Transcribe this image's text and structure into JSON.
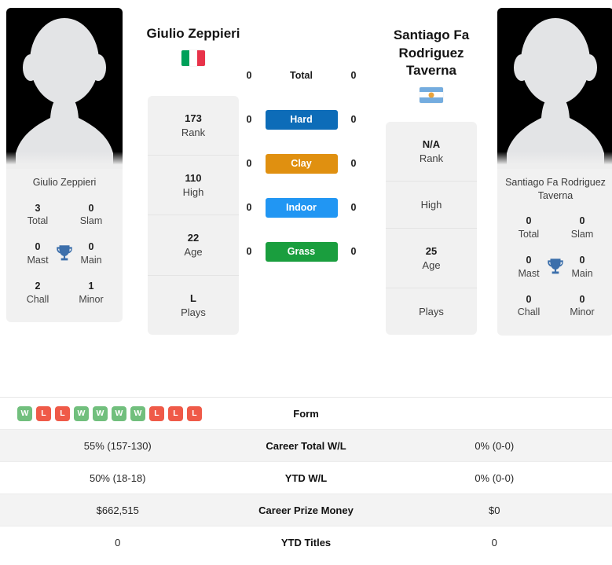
{
  "players": {
    "left": {
      "display_name": "Giulio Zeppieri",
      "headline_name": "Giulio Zeppieri",
      "country": "Italy",
      "flag_colors": [
        "#00a05a",
        "#ffffff",
        "#e8334a"
      ],
      "photo_alt": "player-photo-placeholder",
      "titles": [
        {
          "value": "3",
          "label": "Total"
        },
        {
          "value": "0",
          "label": "Slam"
        },
        {
          "value": "0",
          "label": "Mast"
        },
        {
          "value": "0",
          "label": "Main"
        },
        {
          "value": "2",
          "label": "Chall"
        },
        {
          "value": "1",
          "label": "Minor"
        }
      ],
      "info": [
        {
          "value": "173",
          "label": "Rank"
        },
        {
          "value": "110",
          "label": "High"
        },
        {
          "value": "22",
          "label": "Age"
        },
        {
          "value": "L",
          "label": "Plays"
        }
      ],
      "surface_values": {
        "total": "0",
        "hard": "0",
        "clay": "0",
        "indoor": "0",
        "grass": "0"
      }
    },
    "right": {
      "display_name": "Santiago Fa Rodriguez Taverna",
      "headline_name": "Santiago Fa Rodriguez Taverna",
      "country": "Argentina",
      "flag_colors": [
        "#74acdf",
        "#ffffff",
        "#74acdf"
      ],
      "sun_color": "#e8a33d",
      "photo_alt": "player-photo-placeholder",
      "titles": [
        {
          "value": "0",
          "label": "Total"
        },
        {
          "value": "0",
          "label": "Slam"
        },
        {
          "value": "0",
          "label": "Mast"
        },
        {
          "value": "0",
          "label": "Main"
        },
        {
          "value": "0",
          "label": "Chall"
        },
        {
          "value": "0",
          "label": "Minor"
        }
      ],
      "info": [
        {
          "value": "N/A",
          "label": "Rank"
        },
        {
          "value": "",
          "label": "High"
        },
        {
          "value": "25",
          "label": "Age"
        },
        {
          "value": "",
          "label": "Plays"
        }
      ],
      "surface_values": {
        "total": "0",
        "hard": "0",
        "clay": "0",
        "indoor": "0",
        "grass": "0"
      }
    }
  },
  "surfaces": [
    {
      "key": "total",
      "label": "Total",
      "color": "transparent",
      "text_color": "#1b1b1b"
    },
    {
      "key": "hard",
      "label": "Hard",
      "color": "#0d6cb8",
      "text_color": "#ffffff"
    },
    {
      "key": "clay",
      "label": "Clay",
      "color": "#e09010",
      "text_color": "#ffffff"
    },
    {
      "key": "indoor",
      "label": "Indoor",
      "color": "#2196f3",
      "text_color": "#ffffff"
    },
    {
      "key": "grass",
      "label": "Grass",
      "color": "#1a9e3e",
      "text_color": "#ffffff"
    }
  ],
  "form": {
    "label": "Form",
    "left_results": [
      "W",
      "L",
      "L",
      "W",
      "W",
      "W",
      "W",
      "L",
      "L",
      "L"
    ],
    "right_results": [],
    "win_color": "#71bf7d",
    "loss_color": "#ef5a48"
  },
  "stats_rows": [
    {
      "label": "Career Total W/L",
      "left": "55% (157-130)",
      "right": "0% (0-0)"
    },
    {
      "label": "YTD W/L",
      "left": "50% (18-18)",
      "right": "0% (0-0)"
    },
    {
      "label": "Career Prize Money",
      "left": "$662,515",
      "right": "$0"
    },
    {
      "label": "YTD Titles",
      "left": "0",
      "right": "0"
    }
  ]
}
